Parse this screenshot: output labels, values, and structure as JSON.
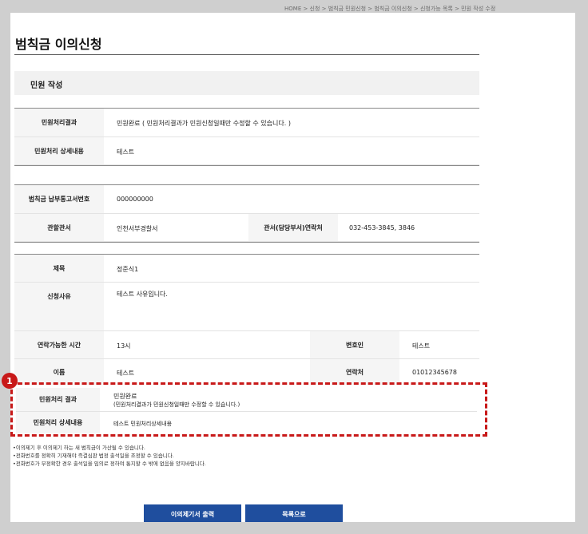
{
  "breadcrumb": "HOME > 신청 > 범칙금 민원신청 > 범칙금 이의신청 > 신청가능 목록 > 민원 작성 수정",
  "page": {
    "title": "범칙금 이의신청",
    "section": "민원 작성"
  },
  "result_block": [
    {
      "label": "민원처리결과",
      "value": "민원완료 ( 민원처리결과가 민원신청일때만 수정할 수 있습니다. )"
    },
    {
      "label": "민원처리 상세내용",
      "value": "테스트"
    }
  ],
  "notice_block": {
    "notice_no_label": "범칙금 납부통고서번호",
    "notice_no": "000000000",
    "office_label": "관할관서",
    "office": "인천서부경찰서",
    "contact_label": "관서(담당부서)연락처",
    "contact": "032-453-3845, 3846"
  },
  "form_block": {
    "subject_label": "제목",
    "subject": "정준식1",
    "reason_label": "신청사유",
    "reason": "테스트 사유입니다.",
    "time_label": "연락가능한 시간",
    "time": "13시",
    "lawyer_label": "변호인",
    "lawyer": "테스트",
    "name_label": "이름",
    "name": "테스트",
    "phone_label": "연락처",
    "phone": "01012345678"
  },
  "highlight": {
    "badge": "1",
    "result_label": "민원처리 결과",
    "result_line1": "민원완료",
    "result_line2": "(민원처리결과가 민원신청일때만 수정할 수 있습니다.)",
    "detail_label": "민원처리 상세내용",
    "detail": "테스트 민원처리상세내용"
  },
  "notes": [
    "•이의제기 후 이의제기 하는 새 범칙금이 가산될 수 있습니다.",
    "•전화번호를 정확히 기재해야 즉결심판 법정 출석일을 조정할 수 있습니다.",
    "•전화번호가 부정확한 경우 출석일을 임의로 정하여 통지할 수 밖에 없음을 양지바랍니다."
  ],
  "buttons": {
    "print": "이의제기서 출력",
    "list": "목록으로"
  },
  "colors": {
    "accent": "#1f4e9e",
    "highlight": "#c81919"
  }
}
